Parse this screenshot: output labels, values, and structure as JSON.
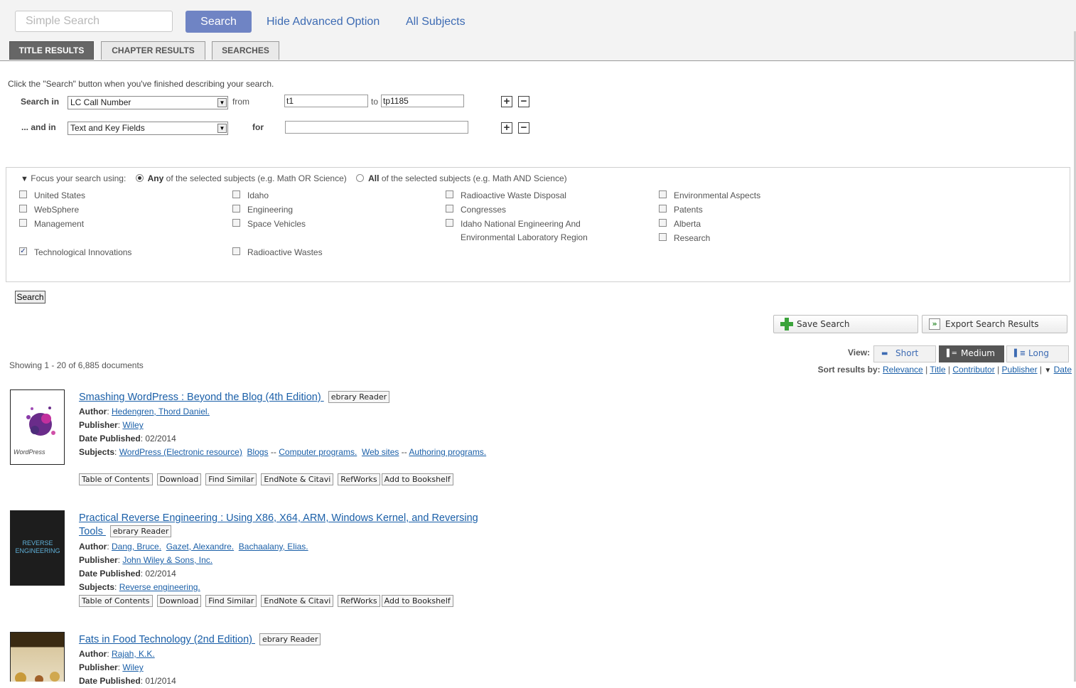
{
  "top": {
    "simple_search_placeholder": "Simple Search",
    "search_button": "Search",
    "hide_advanced": "Hide Advanced Option",
    "all_subjects": "All Subjects"
  },
  "tabs": [
    "TITLE RESULTS",
    "CHAPTER RESULTS",
    "SEARCHES"
  ],
  "advanced": {
    "hint": "Click the \"Search\" button when you've finished describing your search.",
    "row1": {
      "label": "Search in",
      "field": "LC Call Number",
      "from_label": "from",
      "from_value": "t1",
      "to_label": "to",
      "to_value": "tp1185"
    },
    "row2": {
      "label": "... and in",
      "field": "Text and Key Fields",
      "for_label": "for",
      "for_value": ""
    },
    "plus": "+",
    "minus": "−"
  },
  "focus": {
    "arrow": "▼",
    "lead": "Focus your search using:",
    "any_bold": "Any",
    "any_rest": "of the selected subjects (e.g. Math OR Science)",
    "all_bold": "All",
    "all_rest": "of the selected subjects (e.g. Math AND Science)",
    "subjects": [
      {
        "label": "United States",
        "checked": false
      },
      {
        "label": "WebSphere",
        "checked": false
      },
      {
        "label": "Management",
        "checked": false
      },
      {
        "label": "Technological Innovations",
        "checked": true
      },
      {
        "label": "Idaho",
        "checked": false
      },
      {
        "label": "Engineering",
        "checked": false
      },
      {
        "label": "Space Vehicles",
        "checked": false
      },
      {
        "label": "Radioactive Wastes",
        "checked": false
      },
      {
        "label": "Radioactive Waste Disposal",
        "checked": false
      },
      {
        "label": "Congresses",
        "checked": false
      },
      {
        "label": "Idaho National Engineering And Environmental Laboratory Region",
        "checked": false
      },
      {
        "label": "Environmental Aspects",
        "checked": false
      },
      {
        "label": "Patents",
        "checked": false
      },
      {
        "label": "Alberta",
        "checked": false
      },
      {
        "label": "Research",
        "checked": false
      }
    ]
  },
  "search_submit": "Search",
  "actions": {
    "save": "Save Search",
    "export": "Export Search Results"
  },
  "showing": "Showing 1 - 20 of 6,885 documents",
  "view": {
    "label": "View:",
    "options": [
      "Short",
      "Medium",
      "Long"
    ],
    "active": "Medium"
  },
  "sort": {
    "label": "Sort results by:",
    "options": [
      "Relevance",
      "Title",
      "Contributor",
      "Publisher",
      "Date"
    ],
    "sep": "|"
  },
  "result_labels": {
    "author": "Author",
    "publisher": "Publisher",
    "date": "Date Published",
    "subjects": "Subjects",
    "reader_badge": "ebrary Reader",
    "buttons": [
      "Table of Contents",
      "Download",
      "Find Similar",
      "EndNote & Citavi",
      "RefWorks",
      "Add to Bookshelf"
    ]
  },
  "results": [
    {
      "title": "Smashing WordPress : Beyond the Blog (4th Edition)",
      "authors": [
        "Hedengren, Thord Daniel."
      ],
      "publisher": "Wiley",
      "date": "02/2014",
      "subjects_text": [
        "WordPress (Electronic resource)",
        "Blogs",
        "Computer programs.",
        "Web sites",
        "Authoring programs."
      ],
      "cover_text": "WordPress"
    },
    {
      "title": "Practical Reverse Engineering : Using X86, X64, ARM, Windows Kernel, and Reversing Tools",
      "authors": [
        "Dang, Bruce.",
        "Gazet, Alexandre.",
        "Bachaalany, Elias."
      ],
      "publisher": "John Wiley & Sons, Inc.",
      "date": "02/2014",
      "subjects_text": [
        "Reverse engineering."
      ],
      "cover_text": "REVERSE ENGINEERING"
    },
    {
      "title": "Fats in Food Technology (2nd Edition)",
      "authors": [
        "Rajah, K.K."
      ],
      "publisher": "Wiley",
      "date": "01/2014",
      "subjects_text": [],
      "cover_text": ""
    }
  ],
  "colors": {
    "accent": "#6f84c4",
    "link": "#1a5fa8",
    "active_tab": "#666666"
  }
}
